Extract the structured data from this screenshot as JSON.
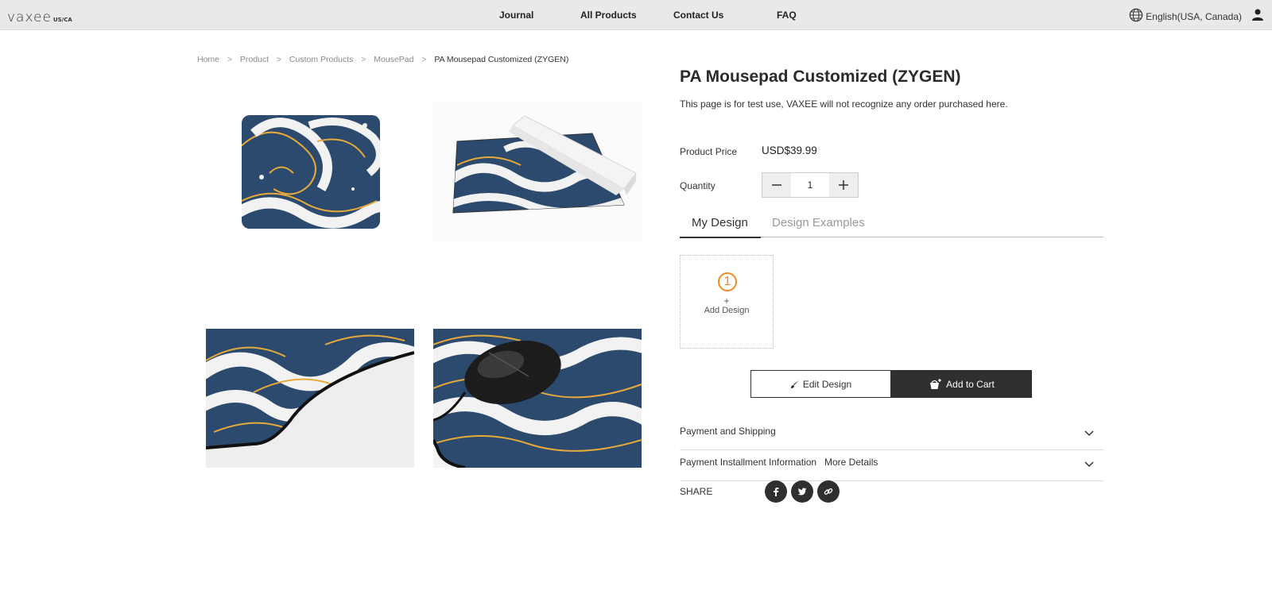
{
  "header": {
    "logo_text": "vaxee",
    "logo_region": "US/CA",
    "nav": [
      {
        "label": "Journal"
      },
      {
        "label": "All Products"
      },
      {
        "label": "Contact Us"
      },
      {
        "label": "FAQ"
      }
    ],
    "language": "English(USA, Canada)"
  },
  "breadcrumb": [
    "Home",
    "Product",
    "Custom Products",
    "MousePad",
    "PA Mousepad Customized (ZYGEN)"
  ],
  "product": {
    "title": "PA Mousepad Customized (ZYGEN)",
    "description": "This page is for test use, VAXEE will not recognize any order purchased here.",
    "price_label": "Product Price",
    "price": "USD$39.99",
    "quantity_label": "Quantity",
    "quantity": "1"
  },
  "tabs": {
    "my_design": "My Design",
    "design_examples": "Design Examples"
  },
  "design": {
    "number": "1",
    "plus": "+",
    "add_label": "Add Design"
  },
  "actions": {
    "edit": "Edit Design",
    "add_to_cart": "Add to Cart"
  },
  "accordion": {
    "shipping": "Payment and Shipping",
    "installment": "Payment Installment Information",
    "installment_more": "More Details"
  },
  "share": {
    "label": "SHARE",
    "icons": [
      "facebook-icon",
      "twitter-icon",
      "link-icon"
    ]
  },
  "colors": {
    "accent": "#f08a24",
    "dark": "#2f2f2f",
    "pad_blue": "#2c4a6e",
    "pad_gold": "#e6a93a"
  }
}
